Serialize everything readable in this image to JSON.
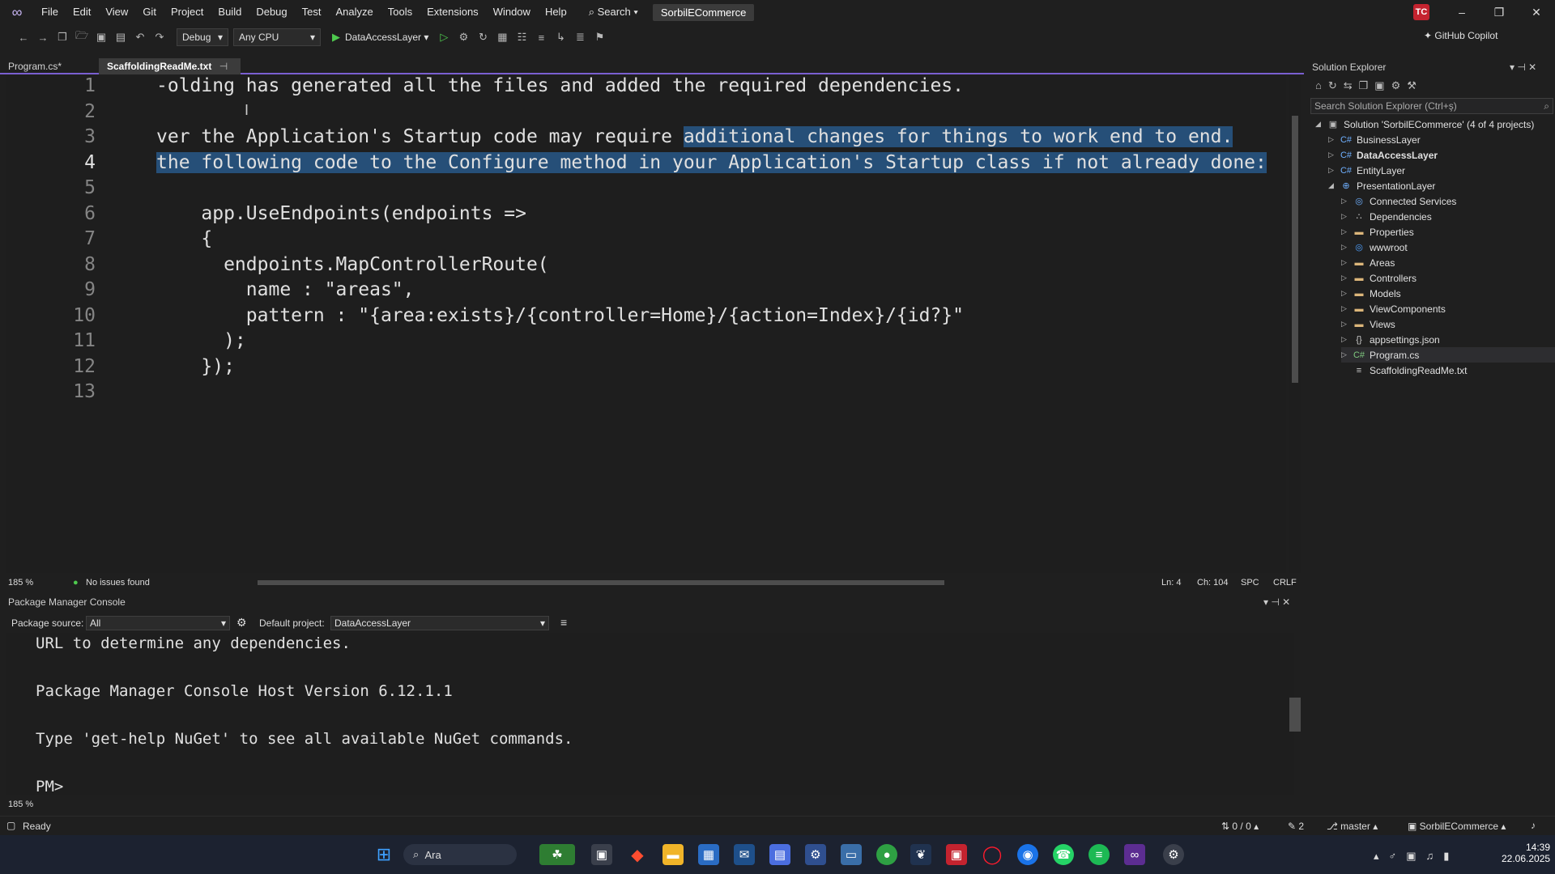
{
  "menubar": {
    "items": [
      "File",
      "Edit",
      "View",
      "Git",
      "Project",
      "Build",
      "Debug",
      "Test",
      "Analyze",
      "Tools",
      "Extensions",
      "Window",
      "Help"
    ],
    "search_label": "Search",
    "solution_name": "SorbilECommerce",
    "avatar_initials": "TC"
  },
  "toolbar": {
    "configuration": "Debug",
    "platform": "Any CPU",
    "run_target": "DataAccessLayer",
    "copilot_label": "GitHub Copilot"
  },
  "editor": {
    "tabs": [
      {
        "label": "Program.cs*",
        "active": false
      },
      {
        "label": "ScaffoldingReadMe.txt",
        "active": true
      }
    ],
    "line_numbers": [
      "1",
      "2",
      "3",
      "4",
      "5",
      "6",
      "7",
      "8",
      "9",
      "10",
      "11",
      "12",
      "13"
    ],
    "lines": [
      "-olding has generated all the files and added the required dependencies.",
      "",
      "ver the Application's Startup code may require ",
      "the following code to the Configure method in your Application's Startup class if not already done:",
      "",
      "    app.UseEndpoints(endpoints =>",
      "    {",
      "      endpoints.MapControllerRoute(",
      "        name : \"areas\",",
      "        pattern : \"{area:exists}/{controller=Home}/{action=Index}/{id?}\"",
      "      );",
      "    });",
      ""
    ],
    "line3_selected": "additional changes for things to work end to end.",
    "status": {
      "zoom": "185 %",
      "issues": "No issues found",
      "ln": "Ln: 4",
      "ch": "Ch: 104",
      "spc": "SPC",
      "eol": "CRLF"
    }
  },
  "pmc": {
    "title": "Package Manager Console",
    "source_label": "Package source:",
    "source_value": "All",
    "project_label": "Default project:",
    "project_value": "DataAccessLayer",
    "lines": [
      "URL to determine any dependencies.",
      "",
      "Package Manager Console Host Version 6.12.1.1",
      "",
      "Type 'get-help NuGet' to see all available NuGet commands.",
      "",
      "PM>"
    ],
    "zoom": "185 %"
  },
  "solution_explorer": {
    "title": "Solution Explorer",
    "search_placeholder": "Search Solution Explorer (Ctrl+ş)",
    "items": [
      {
        "label": "Solution 'SorbilECommerce' (4 of 4 projects)",
        "level": 0,
        "icon": "solution",
        "bold": false
      },
      {
        "label": "BusinessLayer",
        "level": 1,
        "icon": "csproj",
        "bold": false
      },
      {
        "label": "DataAccessLayer",
        "level": 1,
        "icon": "csproj",
        "bold": true
      },
      {
        "label": "EntityLayer",
        "level": 1,
        "icon": "csproj",
        "bold": false
      },
      {
        "label": "PresentationLayer",
        "level": 1,
        "icon": "webproj",
        "bold": false
      },
      {
        "label": "Connected Services",
        "level": 2,
        "icon": "connected",
        "bold": false
      },
      {
        "label": "Dependencies",
        "level": 2,
        "icon": "deps",
        "bold": false
      },
      {
        "label": "Properties",
        "level": 2,
        "icon": "folder",
        "bold": false
      },
      {
        "label": "wwwroot",
        "level": 2,
        "icon": "globe",
        "bold": false
      },
      {
        "label": "Areas",
        "level": 2,
        "icon": "folder",
        "bold": false
      },
      {
        "label": "Controllers",
        "level": 2,
        "icon": "folder",
        "bold": false
      },
      {
        "label": "Models",
        "level": 2,
        "icon": "folder",
        "bold": false
      },
      {
        "label": "ViewComponents",
        "level": 2,
        "icon": "folder",
        "bold": false
      },
      {
        "label": "Views",
        "level": 2,
        "icon": "folder",
        "bold": false
      },
      {
        "label": "appsettings.json",
        "level": 2,
        "icon": "json",
        "bold": false
      },
      {
        "label": "Program.cs",
        "level": 2,
        "icon": "cs",
        "bold": false
      },
      {
        "label": "ScaffoldingReadMe.txt",
        "level": 2,
        "icon": "txt",
        "bold": false
      }
    ]
  },
  "statusbar": {
    "ready": "Ready",
    "changes": "0 / 0",
    "edits": "2",
    "branch": "master",
    "repo": "SorbilECommerce"
  },
  "taskbar": {
    "search_label": "Ara",
    "time": "14:39",
    "date": "22.06.2025"
  },
  "colors": {
    "accent": "#7a5fd1",
    "selection": "#264f78",
    "editor_bg": "#1e1e1e",
    "chrome_bg": "#1f1f1f"
  }
}
